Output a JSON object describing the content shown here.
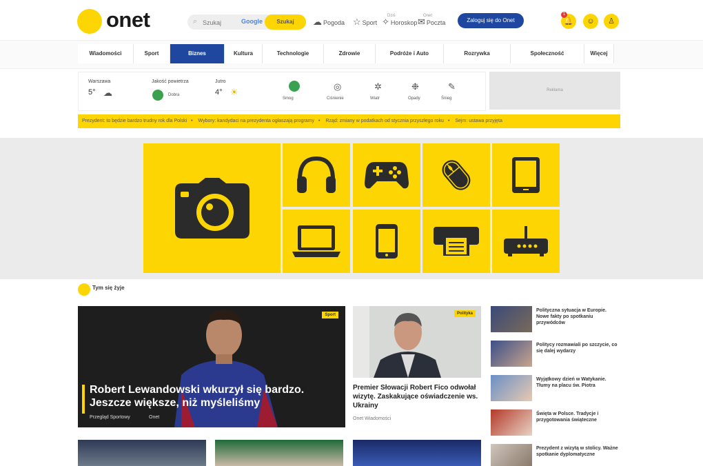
{
  "brand": {
    "name": "onet"
  },
  "search": {
    "placeholder": "Szukaj",
    "engine": "Google",
    "button": "Szukaj"
  },
  "header_links": [
    {
      "label": "Pogoda",
      "icon": "cloud-icon"
    },
    {
      "label": "Sport",
      "icon": "star-icon"
    },
    {
      "label": "Horoskop",
      "icon": "stars-icon",
      "sup": "Dziś"
    },
    {
      "label": "Poczta",
      "icon": "mail-icon",
      "sup": "Onet"
    }
  ],
  "cta_label": "Zaloguj się do Onet",
  "notifications_count": "1",
  "nav": [
    "Wiadomości",
    "Sport",
    "Biznes",
    "Kultura",
    "Technologie",
    "Zdrowie",
    "Podróże i Auto",
    "Rozrywka",
    "Społeczność",
    "Więcej"
  ],
  "weather": {
    "city_label": "Warszawa",
    "temp": "5°",
    "air_label": "Jakość powietrza",
    "air_status": "Dobra",
    "second_temp": "4°",
    "second_label": "Jutro",
    "icons": [
      "Smog",
      "Ciśnienie",
      "Wiatr",
      "Opady",
      "Śnieg"
    ]
  },
  "ad_label": "Reklama",
  "ticker": [
    "Prezydent: to będzie bardzo trudny rok dla Polski",
    "Wybory: kandydaci na prezydenta ogłaszają programy",
    "Rząd: zmiany w podatkach od stycznia przyszłego roku",
    "Sejm: ustawa przyjęta"
  ],
  "tiles": [
    "camera-icon",
    "headphones-icon",
    "gamepad-icon",
    "mouse-icon",
    "tablet-icon",
    "laptop-icon",
    "smartphone-icon",
    "printer-icon",
    "router-icon"
  ],
  "section": {
    "title": "Tym się żyje"
  },
  "main_story": {
    "tag": "Sport",
    "headline": "Robert Lewandowski wkurzył się bardzo. Jeszcze większe, niż myśleliśmy",
    "author": "Przegląd Sportowy",
    "source": "Onet"
  },
  "mid_story": {
    "tag": "Polityka",
    "headline": "Premier Słowacji Robert Fico odwołał wizytę. Zaskakujące oświadczenie ws. Ukrainy",
    "meta": "Onet Wiadomości"
  },
  "side_stories": [
    "Polityczna sytuacja w Europie. Nowe fakty po spotkaniu przywódców",
    "Politycy rozmawiali po szczycie, co się dalej wydarzy",
    "Wyjątkowy dzień w Watykanie. Tłumy na placu św. Piotra",
    "Święta w Polsce. Tradycje i przygotowania świąteczne",
    "Prezydent z wizytą w stolicy. Ważne spotkanie dyplomatyczne"
  ]
}
